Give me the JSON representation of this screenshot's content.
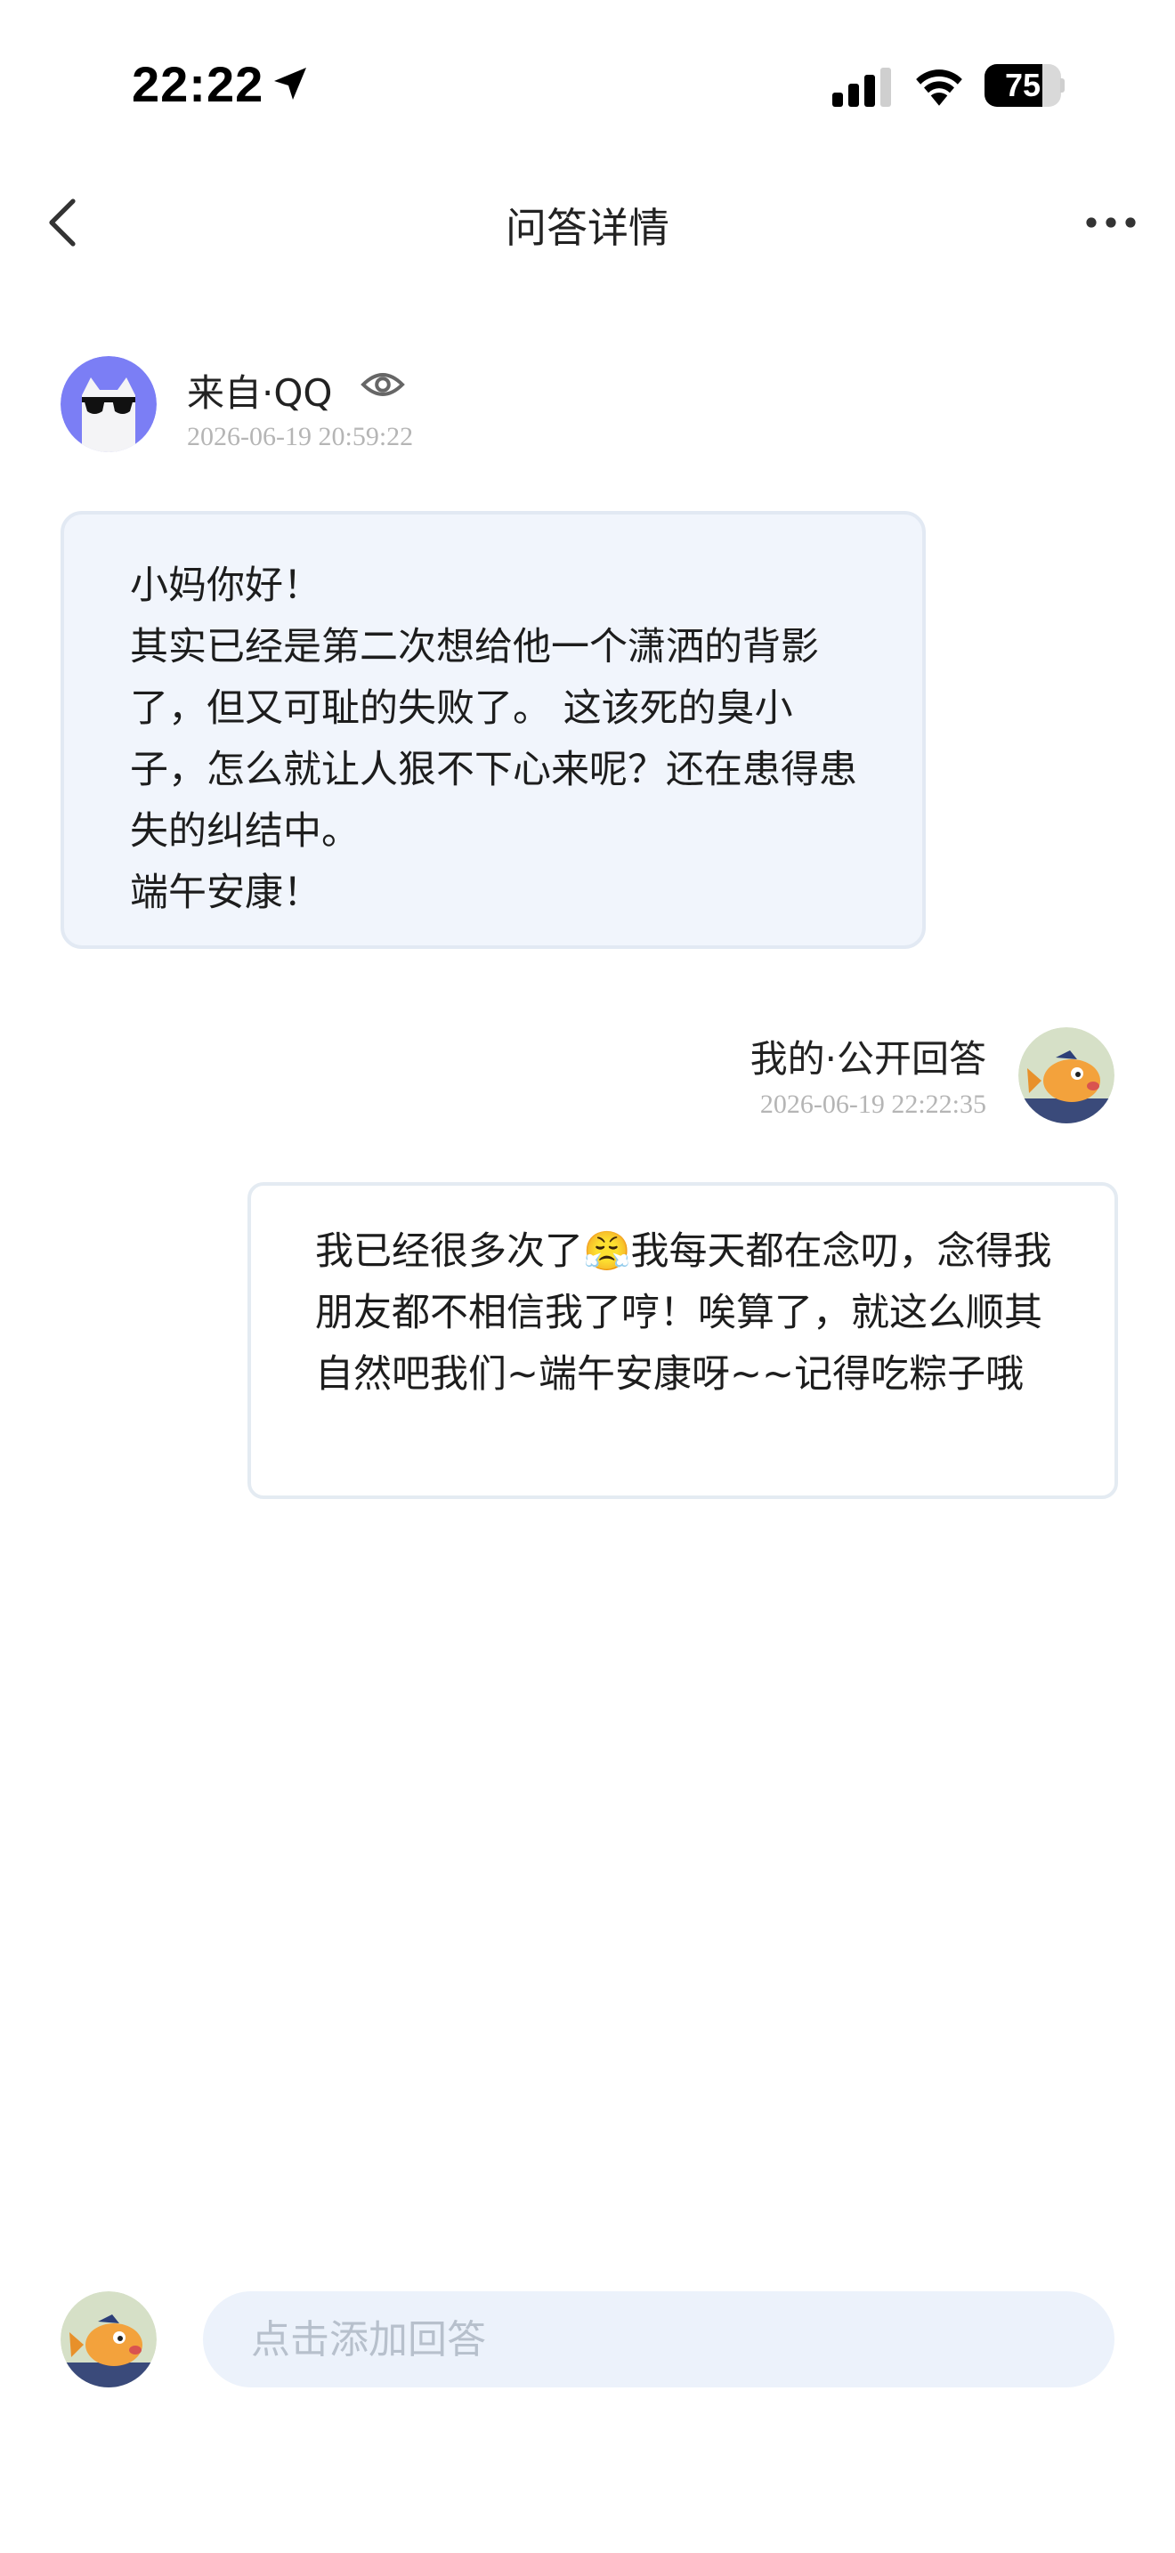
{
  "status_bar": {
    "time": "22:22",
    "battery_level": "75",
    "battery_fraction": 0.75
  },
  "nav": {
    "title": "问答详情"
  },
  "question": {
    "sender": "来自·QQ",
    "timestamp": "2026-06-19 20:59:22",
    "content": "小妈你好！\n其实已经是第二次想给他一个潇洒的背影了，但又可耻的失败了。 这该死的臭小子，怎么就让人狠不下心来呢？还在患得患失的纠结中。\n端午安康！"
  },
  "answer": {
    "label": "我的·公开回答",
    "timestamp": "2026-06-19 22:22:35",
    "content": "我已经很多次了😤我每天都在念叨，念得我朋友都不相信我了哼！唉算了，就这么顺其自然吧我们~端午安康呀~~记得吃粽子哦"
  },
  "reply_bar": {
    "placeholder": "点击添加回答"
  },
  "colors": {
    "question_bubble_bg": "#f1f5fc",
    "timestamp": "#b5b5b5",
    "input_bg": "#ecf2fb",
    "avatar_purple": "#7b7ef5"
  },
  "icons": {
    "back": "back-chevron-icon",
    "more": "more-dots-icon",
    "eye": "eye-icon",
    "location": "location-arrow-icon",
    "signal": "cellular-signal-icon",
    "wifi": "wifi-icon"
  }
}
